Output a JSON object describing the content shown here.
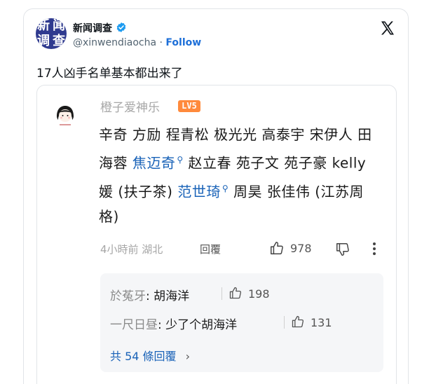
{
  "tweet": {
    "author_name": "新闻调查",
    "handle": "@xinwendiaocha",
    "separator": "·",
    "follow_label": "Follow",
    "avatar_text": [
      "新",
      "闻",
      "调",
      "查"
    ],
    "text": "17人凶手名单基本都出来了"
  },
  "quoted_comment": {
    "user_name": "橙子爱神乐",
    "level_badge": "LV5",
    "body_parts": [
      {
        "text": "辛奇 方励 程青松 极光光 高泰宇 宋伊人 田海蓉 ",
        "type": "plain"
      },
      {
        "text": "焦迈奇",
        "type": "link"
      },
      {
        "text": " 赵立春 苑子文 苑子豪 kelly媛 (扶子茶) ",
        "type": "plain"
      },
      {
        "text": "范世琦",
        "type": "link"
      },
      {
        "text": " 周昊 张佳伟 (江苏周格)",
        "type": "plain"
      }
    ],
    "time_location": "4小時前 湖北",
    "reply_label": "回覆",
    "like_count": "978"
  },
  "replies": [
    {
      "user": "於菟牙",
      "text": "胡海洋",
      "likes": "198"
    },
    {
      "user": "一尺日昼",
      "text": "少了个胡海洋",
      "likes": "131"
    }
  ],
  "total_replies_label": "共 54 條回覆",
  "colors": {
    "accent": "#1d6fd8",
    "badge": "#ff8a3c",
    "link": "#1a63b8"
  }
}
